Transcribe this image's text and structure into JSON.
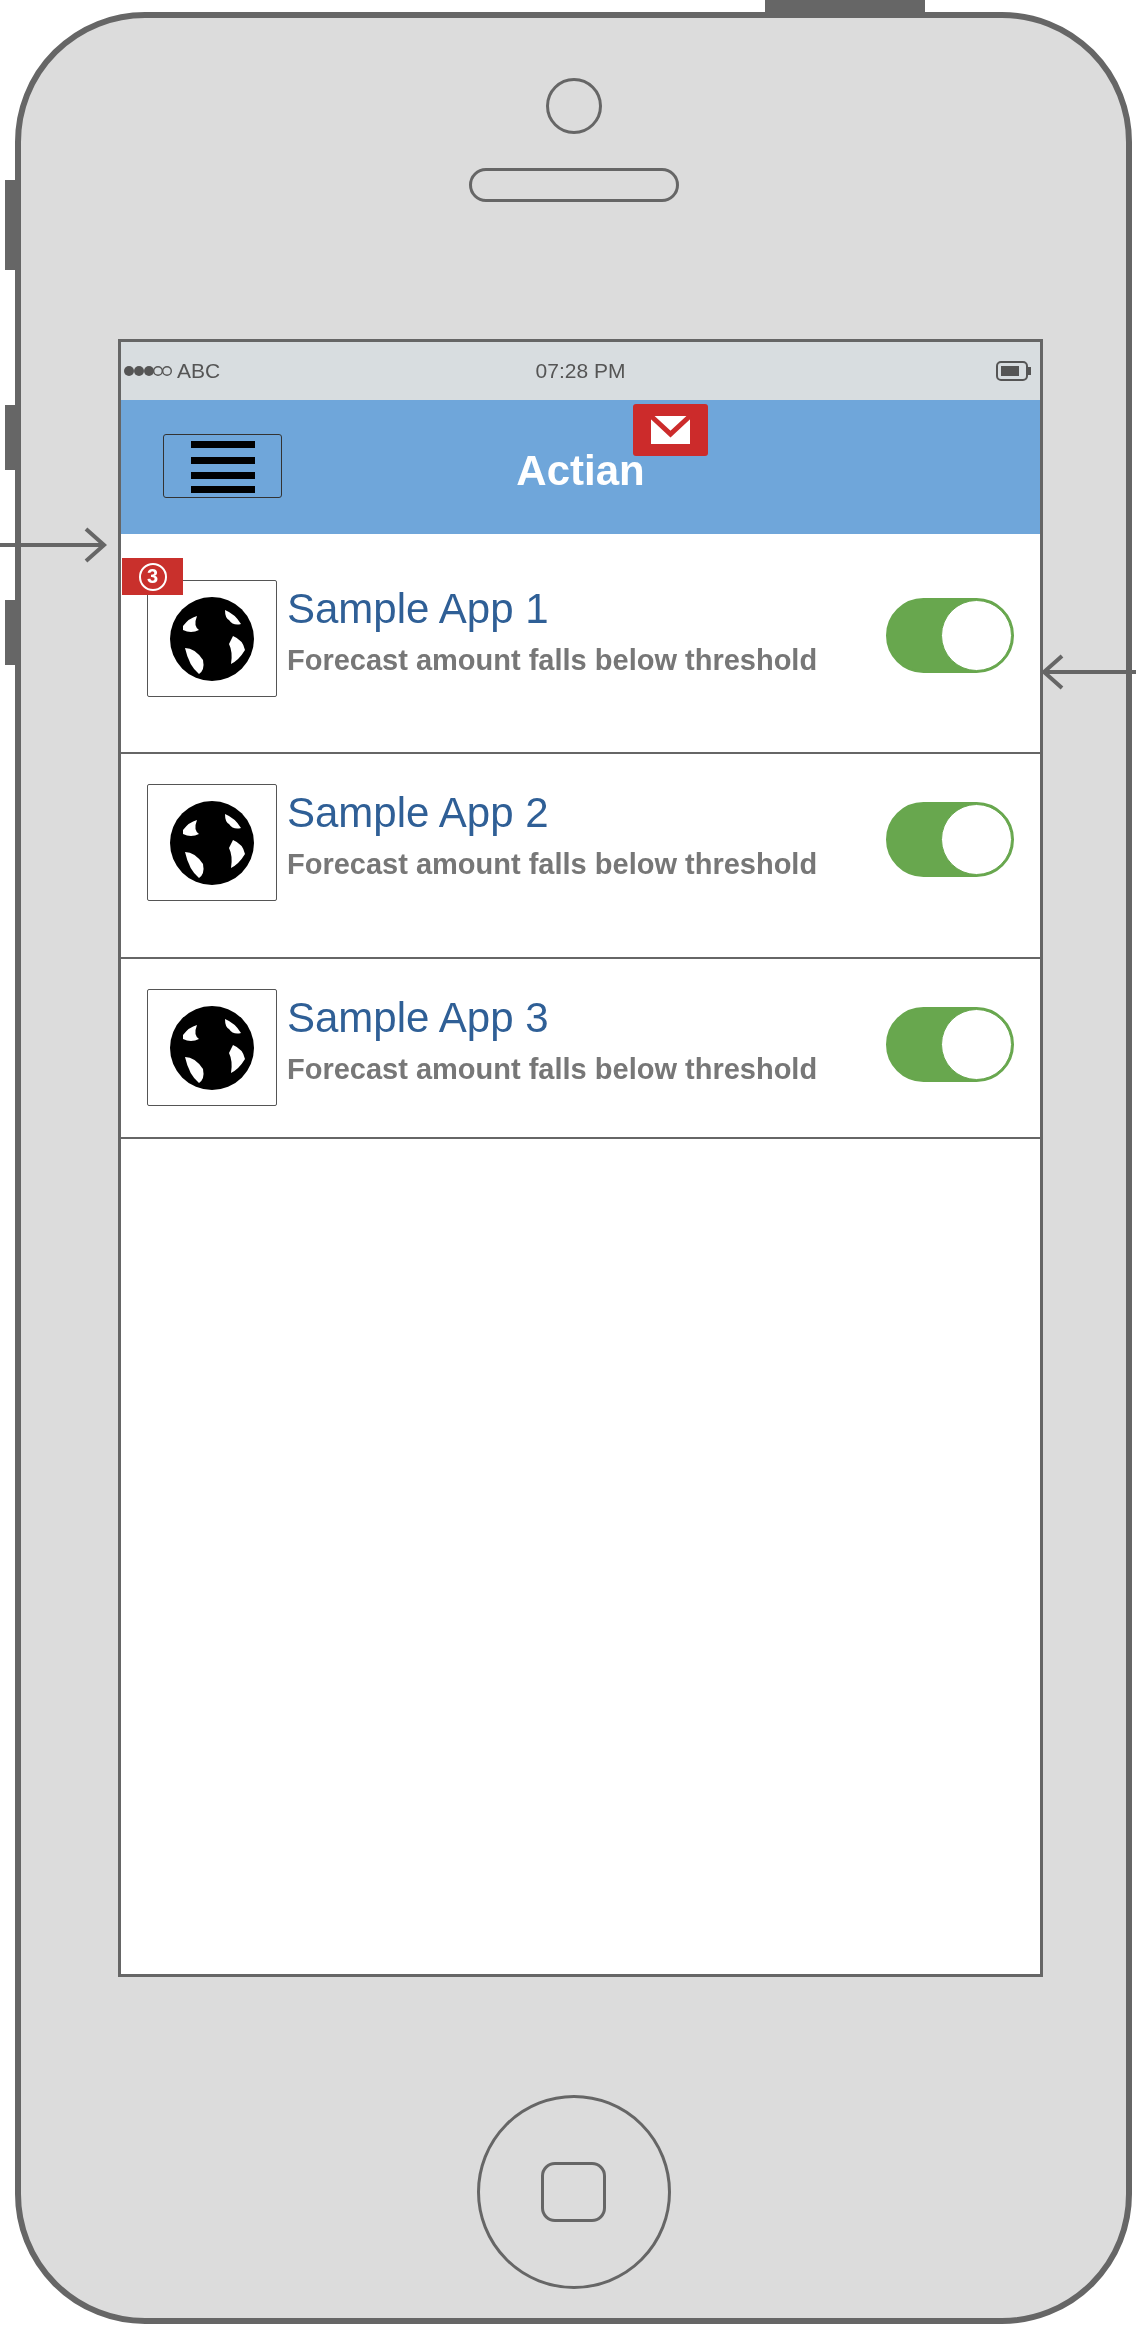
{
  "status_bar": {
    "carrier": "ABC",
    "time": "07:28 PM"
  },
  "header": {
    "title": "Actian"
  },
  "rows": [
    {
      "title": "Sample App 1",
      "subtitle": "Forecast amount falls below threshold",
      "on": true,
      "badge": "3"
    },
    {
      "title": "Sample App 2",
      "subtitle": "Forecast amount falls below threshold",
      "on": true
    },
    {
      "title": "Sample App 3",
      "subtitle": "Forecast amount falls below threshold",
      "on": true
    }
  ]
}
